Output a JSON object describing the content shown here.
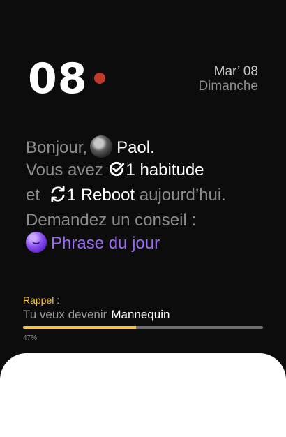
{
  "header": {
    "day_number": "08",
    "date_short": "Mar’ 08",
    "weekday": "Dimanche",
    "dot_color": "#c0382b"
  },
  "greeting": {
    "hello": "Bonjour,",
    "user_name": "Paol.",
    "you_have": "Vous avez",
    "habit_count_label": "1 habitude",
    "and": "et",
    "reboot_count_label": "1 Reboot",
    "today": "aujourd’hui.",
    "ask_advice": "Demandez un conseil :",
    "phrase_link": "Phrase du jour",
    "accent_color": "#9b6cf3"
  },
  "reminder": {
    "label": "Rappel :",
    "prefix": "Tu veux devenir",
    "goal": "Mannequin",
    "progress_percent": 47,
    "progress_text": "47%",
    "accent_color": "#f4c542"
  }
}
